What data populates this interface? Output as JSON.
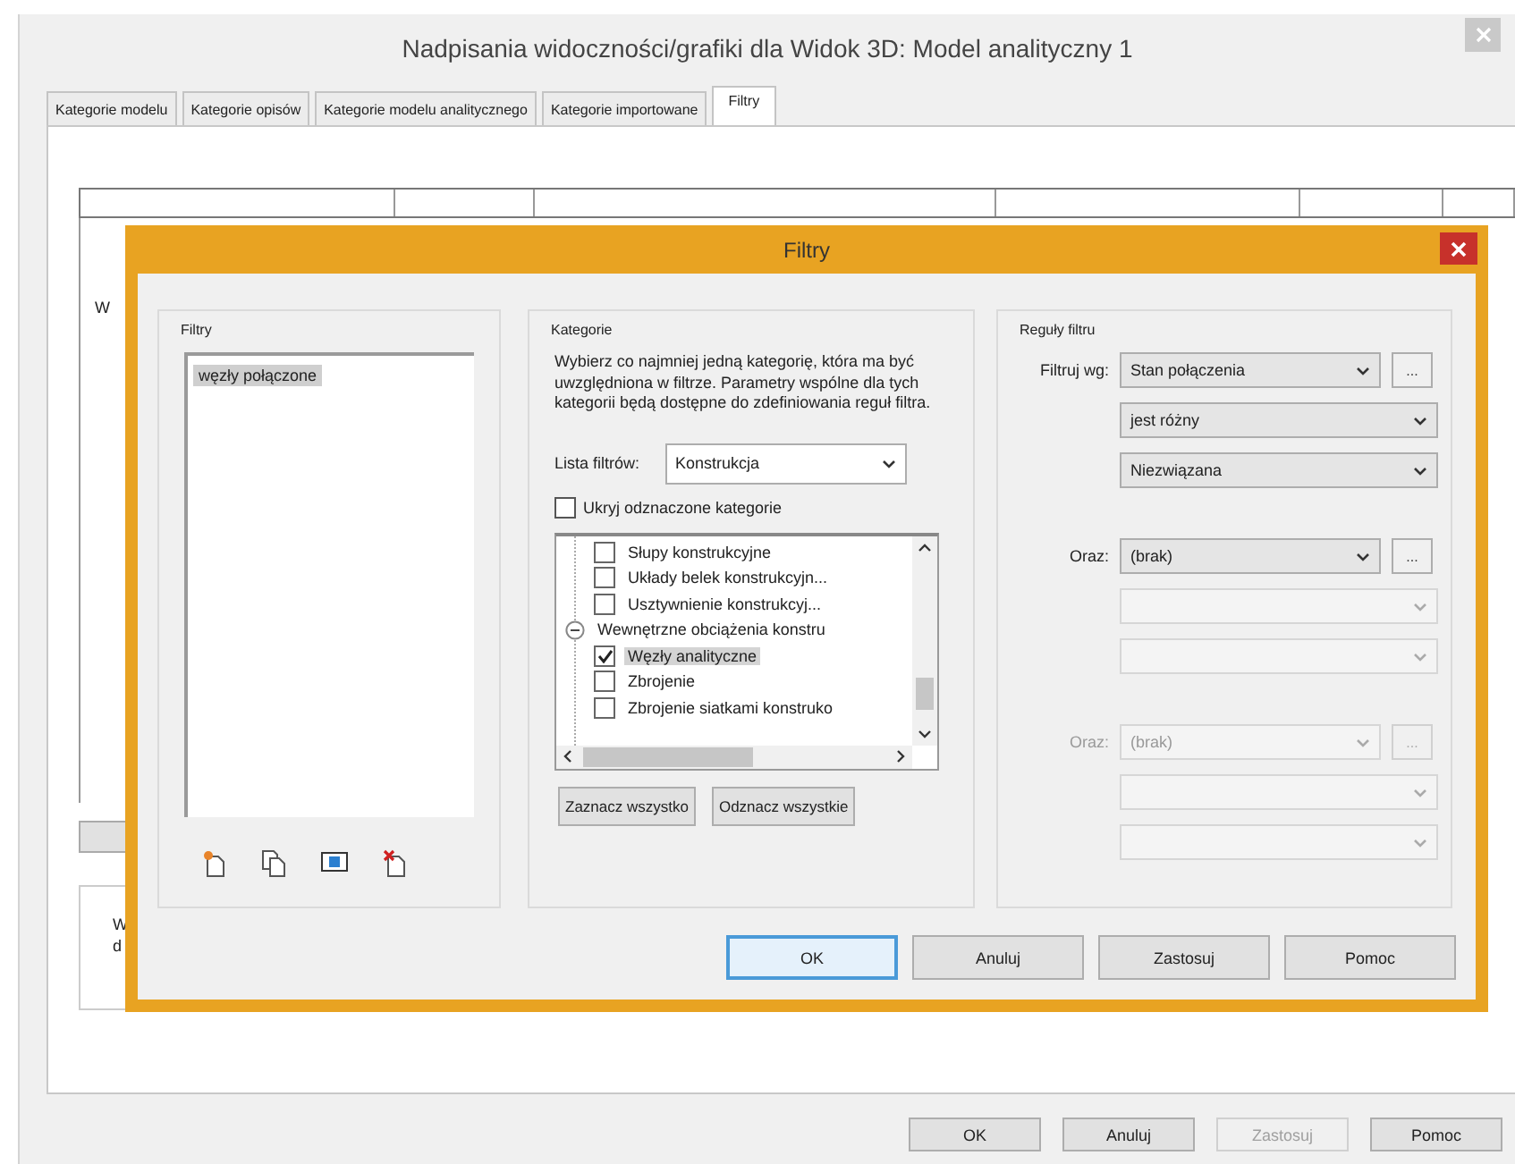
{
  "window": {
    "title": "Nadpisania widoczności/grafiki dla Widok 3D: Model analityczny 1"
  },
  "tabs": [
    {
      "label": "Kategorie modelu",
      "selected": false
    },
    {
      "label": "Kategorie opisów",
      "selected": false
    },
    {
      "label": "Kategorie modelu analitycznego",
      "selected": false
    },
    {
      "label": "Kategorie importowane",
      "selected": false
    },
    {
      "label": "Filtry",
      "selected": true
    }
  ],
  "table": {
    "row_text": "W"
  },
  "note": {
    "lines": [
      "W",
      "d"
    ]
  },
  "buttons": [
    {
      "label": "OK",
      "disabled": false
    },
    {
      "label": "Anuluj",
      "disabled": false
    },
    {
      "label": "Zastosuj",
      "disabled": true
    },
    {
      "label": "Pomoc",
      "disabled": false
    }
  ],
  "dialog": {
    "title": "Filtry",
    "filters": {
      "title": "Filtry",
      "items": [
        {
          "label": "węzły połączone",
          "selected": true
        }
      ]
    },
    "categories": {
      "title": "Kategorie",
      "instructions": "Wybierz co najmniej jedną kategorię, która ma być uwzględniona w filtrze. Parametry wspólne dla tych kategorii będą dostępne do zdefiniowania reguł filtra.",
      "filter_list_label": "Lista filtrów:",
      "filter_list_value": "Konstrukcja",
      "hide_unchecked": {
        "label": "Ukryj odznaczone kategorie",
        "checked": false
      },
      "tree": [
        {
          "kind": "leaf",
          "label": "Słupy konstrukcyjne",
          "checked": false,
          "selected": false
        },
        {
          "kind": "leaf",
          "label": "Układy belek konstrukcyjn...",
          "checked": false,
          "selected": false
        },
        {
          "kind": "leaf",
          "label": "Usztywnienie konstrukcyj...",
          "checked": false,
          "selected": false
        },
        {
          "kind": "group",
          "label": "Wewnętrzne obciążenia konstru",
          "expanded": true,
          "selected": false,
          "children": [
            {
              "kind": "leaf",
              "label": "Węzły analityczne",
              "checked": true,
              "selected": true
            },
            {
              "kind": "leaf",
              "label": "Zbrojenie",
              "checked": false,
              "selected": false
            },
            {
              "kind": "leaf",
              "label": "Zbrojenie siatkami konstruko",
              "checked": false,
              "selected": false
            }
          ]
        }
      ],
      "buttons": [
        "Zaznacz wszystko",
        "Odznacz wszystkie"
      ]
    },
    "rules": {
      "title": "Reguły filtru",
      "items": [
        {
          "label": "Filtruj wg:",
          "disabled": false,
          "browse": "...",
          "field": "Stan połączenia",
          "operator": "jest różny",
          "value": "Niezwiązana"
        },
        {
          "label": "Oraz:",
          "disabled": false,
          "browse": "...",
          "field": "(brak)"
        },
        {
          "label": "Oraz:",
          "disabled": true,
          "browse": "...",
          "field": "(brak)"
        }
      ]
    },
    "buttons": [
      {
        "label": "OK",
        "focused": true
      },
      {
        "label": "Anuluj",
        "focused": false
      },
      {
        "label": "Zastosuj",
        "focused": false
      },
      {
        "label": "Pomoc",
        "focused": false
      }
    ]
  }
}
